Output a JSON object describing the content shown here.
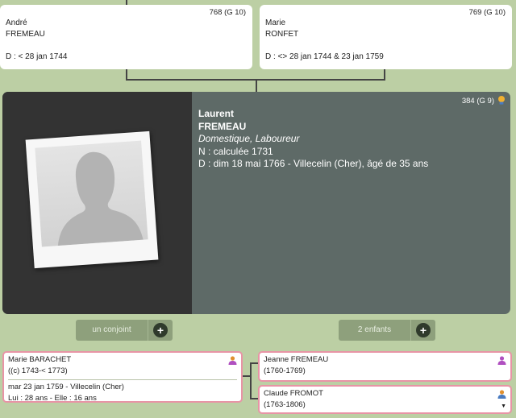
{
  "parents": {
    "father": {
      "sosa": "768 (G 10)",
      "first_name": "André",
      "last_name": "FREMEAU",
      "death": "D : < 28 jan 1744"
    },
    "mother": {
      "sosa": "769 (G 10)",
      "first_name": "Marie",
      "last_name": "RONFET",
      "death": "D : <> 28 jan 1744 & 23 jan 1759"
    }
  },
  "main_person": {
    "sosa": "384 (G 9)",
    "first_name": "Laurent",
    "last_name": "FREMEAU",
    "occupation": "Domestique, Laboureur",
    "birth": "N : calculée 1731",
    "death": "D : dim 18 mai 1766 - Villecelin (Cher),  âgé de 35 ans"
  },
  "actions": {
    "spouse_label": "un conjoint",
    "children_label": "2 enfants"
  },
  "spouse": {
    "name": "Marie BARACHET",
    "dates": "((c) 1743-< 1773)",
    "marriage": "mar 23 jan 1759 - Villecelin (Cher)",
    "ages": "Lui : 28 ans - Elle : 16 ans"
  },
  "children": [
    {
      "name": "Jeanne FREMEAU",
      "dates": "(1760-1769)"
    },
    {
      "name": "Claude FROMOT",
      "dates": "(1763-1806)"
    }
  ],
  "colors": {
    "background": "#bccfa4",
    "info_panel": "#5e6a67",
    "photo_panel": "#333333",
    "card_border_pink": "#e894a6",
    "female_icon": "#b050c0",
    "male_icon": "#e09030",
    "button": "#8ea07c"
  },
  "icons": {
    "photo": "silhouette-placeholder-icon",
    "main": "lightbulb-icon",
    "spouse": "female-person-icon",
    "child_1": "female-person-icon",
    "child_2": "male-person-icon",
    "add": "plus-icon",
    "expand": "chevron-down-icon"
  }
}
